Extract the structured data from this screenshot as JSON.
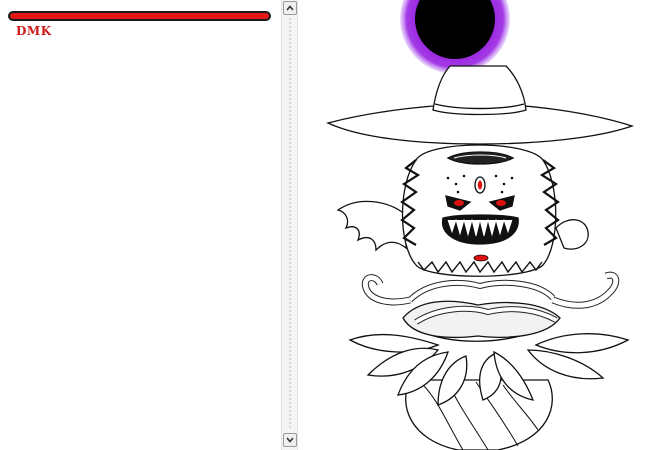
{
  "boss": {
    "name": "DMK",
    "hp_fraction": 1.0,
    "hp_bar_color": "#e01818"
  },
  "portal": {
    "ring_color": "#9a28e0",
    "core_color": "#000000"
  },
  "scrollbar": {
    "up_icon": "chevron-up-icon",
    "down_icon": "chevron-down-icon"
  },
  "colors": {
    "eye": "#e01010",
    "ink": "#111111"
  }
}
